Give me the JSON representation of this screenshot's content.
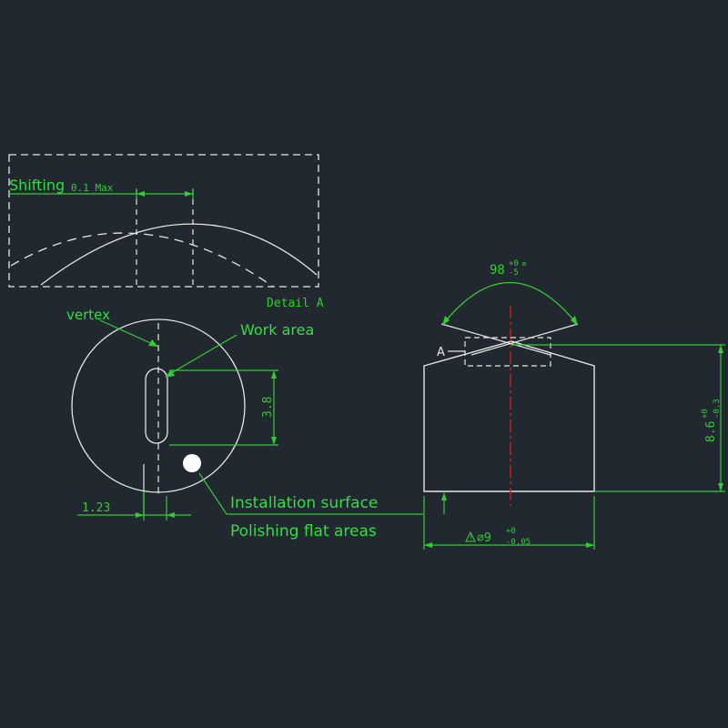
{
  "colors": {
    "background": "#212830",
    "outline": "#e6e6e6",
    "dimension": "#33cc33",
    "label": "#33dd44",
    "centerline": "#d42020"
  },
  "detail": {
    "shifting_label": "Shifting",
    "tolerance_label": "0.1 Max",
    "caption": "Detail A"
  },
  "top_view": {
    "vertex_label": "vertex",
    "work_area_label": "Work area",
    "slot_height_dim": "3.8",
    "offset_dim": "1.23"
  },
  "callouts": {
    "installation_surface": "Installation surface",
    "polishing_flat_areas": "Polishing flat areas"
  },
  "side_view": {
    "angle_base": "98",
    "angle_tol_upper": "+0",
    "angle_tol_lower": "-5",
    "angle_unit": "°",
    "detail_ref": "A",
    "height_base": "8.6",
    "height_tol_upper": "+0",
    "height_tol_lower": "-0.3",
    "diameter_prefix": "⌀9",
    "diameter_tol_upper": "+0",
    "diameter_tol_lower": "-0.05",
    "warning_symbol": "!"
  }
}
